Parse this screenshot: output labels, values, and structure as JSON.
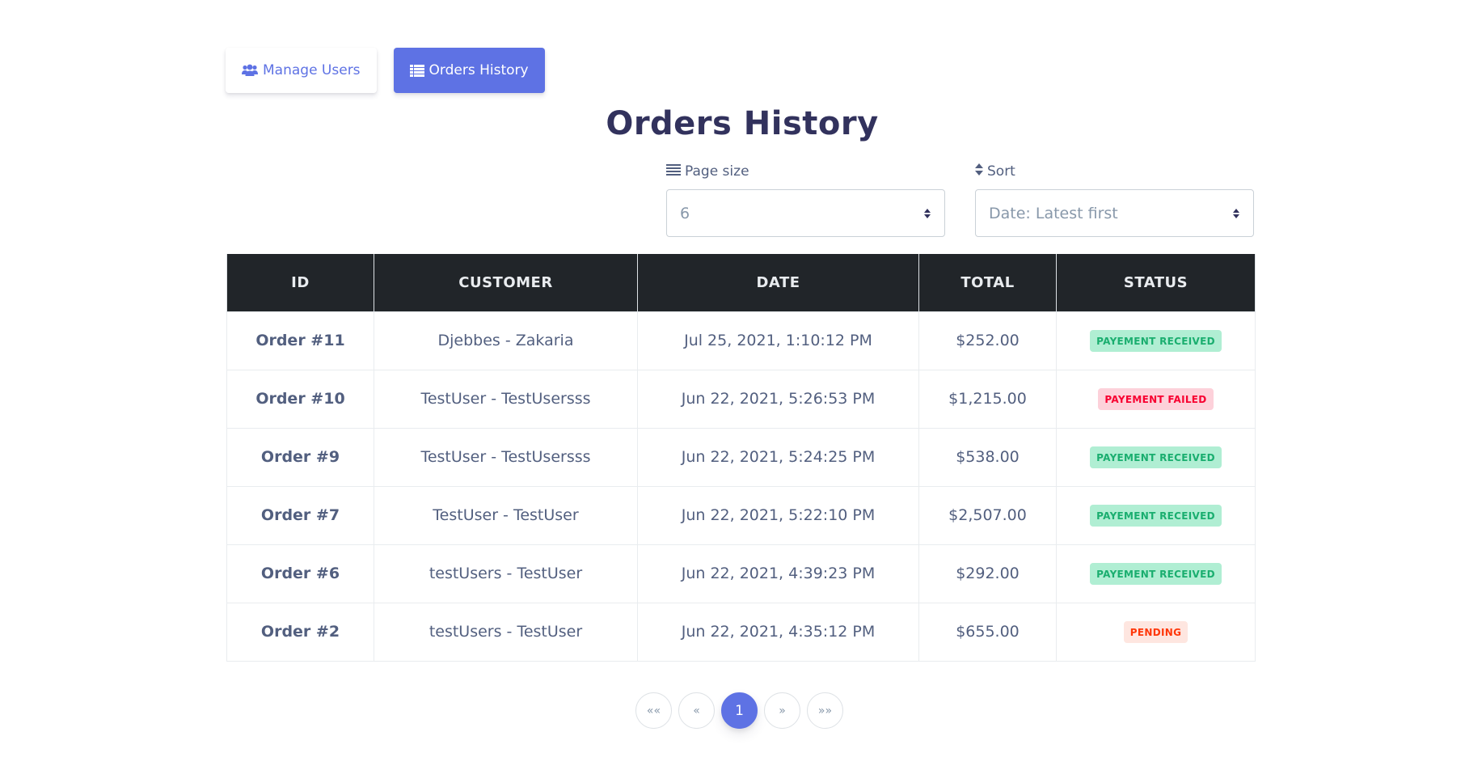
{
  "nav": {
    "manage_users": {
      "label": "Manage Users",
      "icon": "users-icon"
    },
    "orders_history": {
      "label": "Orders History",
      "icon": "list-icon"
    }
  },
  "page_title": "Orders History",
  "controls": {
    "page_size": {
      "label": "Page size",
      "icon": "bars-icon",
      "value": "6"
    },
    "sort": {
      "label": "Sort",
      "icon": "sort-icon",
      "value": "Date: Latest first"
    }
  },
  "table": {
    "headers": [
      "ID",
      "CUSTOMER",
      "DATE",
      "TOTAL",
      "STATUS"
    ],
    "rows": [
      {
        "id": "Order #11",
        "customer": "Djebbes - Zakaria",
        "date": "Jul 25, 2021, 1:10:12 PM",
        "total": "$252.00",
        "status": "PAYEMENT RECEIVED",
        "status_kind": "success"
      },
      {
        "id": "Order #10",
        "customer": "TestUser - TestUsersss",
        "date": "Jun 22, 2021, 5:26:53 PM",
        "total": "$1,215.00",
        "status": "PAYEMENT FAILED",
        "status_kind": "danger"
      },
      {
        "id": "Order #9",
        "customer": "TestUser - TestUsersss",
        "date": "Jun 22, 2021, 5:24:25 PM",
        "total": "$538.00",
        "status": "PAYEMENT RECEIVED",
        "status_kind": "success"
      },
      {
        "id": "Order #7",
        "customer": "TestUser - TestUser",
        "date": "Jun 22, 2021, 5:22:10 PM",
        "total": "$2,507.00",
        "status": "PAYEMENT RECEIVED",
        "status_kind": "success"
      },
      {
        "id": "Order #6",
        "customer": "testUsers - TestUser",
        "date": "Jun 22, 2021, 4:39:23 PM",
        "total": "$292.00",
        "status": "PAYEMENT RECEIVED",
        "status_kind": "success"
      },
      {
        "id": "Order #2",
        "customer": "testUsers - TestUser",
        "date": "Jun 22, 2021, 4:35:12 PM",
        "total": "$655.00",
        "status": "PENDING",
        "status_kind": "warning"
      }
    ]
  },
  "pagination": {
    "first": "««",
    "prev": "«",
    "current": "1",
    "next": "»",
    "last": "»»"
  },
  "colors": {
    "primary": "#5e72e4",
    "table_header": "#212529",
    "title": "#32325d"
  }
}
